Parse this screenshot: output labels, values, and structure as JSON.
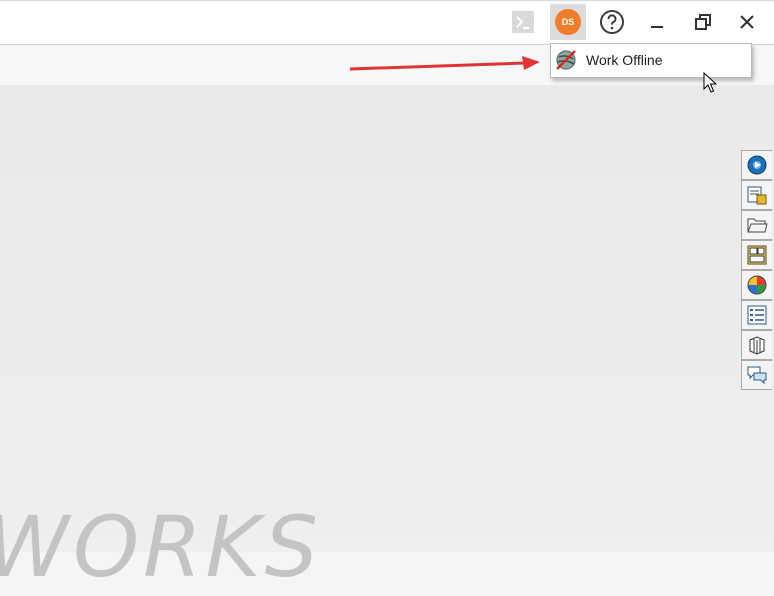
{
  "titlebar": {
    "avatar_initials": "DS",
    "icons": [
      "command-prompt-icon",
      "help-icon",
      "minimize-icon",
      "restore-icon",
      "close-icon"
    ]
  },
  "account_menu": {
    "items": [
      {
        "label": "Work Offline",
        "icon": "work-offline-icon"
      }
    ]
  },
  "task_pane": {
    "tabs": [
      {
        "icon": "resources-icon"
      },
      {
        "icon": "design-library-icon"
      },
      {
        "icon": "file-explorer-icon"
      },
      {
        "icon": "view-palette-icon"
      },
      {
        "icon": "appearances-icon"
      },
      {
        "icon": "custom-properties-icon"
      },
      {
        "icon": "3d-content-icon"
      },
      {
        "icon": "forum-icon"
      }
    ]
  },
  "background": {
    "logo_text": "WORKS"
  },
  "colors": {
    "avatar": "#ee7d2b",
    "annotation_arrow": "#e03434"
  }
}
